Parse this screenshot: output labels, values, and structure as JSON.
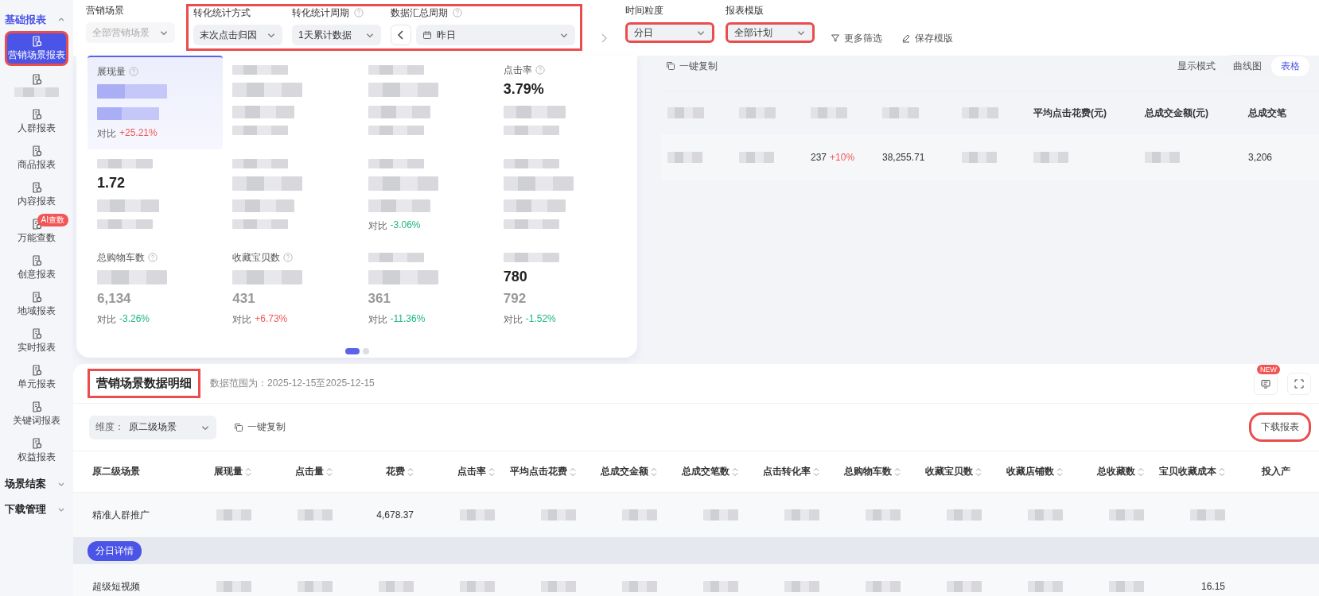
{
  "sidebar": {
    "groups": [
      {
        "label": "基础报表",
        "expanded": true,
        "items": [
          {
            "kind": "item",
            "label": "营销场景报表",
            "selected": true,
            "highlighted": true
          },
          {
            "kind": "redacted",
            "selected": false,
            "highlighted": false
          },
          {
            "kind": "item",
            "label": "人群报表",
            "selected": false,
            "highlighted": false
          },
          {
            "kind": "item",
            "label": "商品报表",
            "selected": false,
            "highlighted": false
          },
          {
            "kind": "item",
            "label": "内容报表",
            "selected": false,
            "highlighted": false
          },
          {
            "kind": "item",
            "label": "万能查数",
            "badge": "AI查数",
            "selected": false,
            "highlighted": false
          },
          {
            "kind": "item",
            "label": "创意报表",
            "selected": false,
            "highlighted": false
          },
          {
            "kind": "item",
            "label": "地域报表",
            "selected": false,
            "highlighted": false
          },
          {
            "kind": "item",
            "label": "实时报表",
            "selected": false,
            "highlighted": false
          },
          {
            "kind": "item",
            "label": "单元报表",
            "selected": false,
            "highlighted": false
          },
          {
            "kind": "item",
            "label": "关键词报表",
            "selected": false,
            "highlighted": false
          },
          {
            "kind": "item",
            "label": "权益报表",
            "selected": false,
            "highlighted": false
          }
        ]
      },
      {
        "label": "场景结案",
        "expanded": false
      },
      {
        "label": "下载管理",
        "expanded": false
      }
    ]
  },
  "filter_groups": [
    {
      "highlighted": false,
      "fields": [
        {
          "kind": "select",
          "label": "营销场景",
          "placeholder": "全部营销场景",
          "disabled": true,
          "highlighted": false
        }
      ]
    },
    {
      "highlighted": true,
      "fields": [
        {
          "kind": "select",
          "label": "转化统计方式",
          "value": "末次点击归因",
          "highlighted": false
        },
        {
          "kind": "select",
          "label": "转化统计周期",
          "help": true,
          "value": "1天累计数据",
          "highlighted": false
        },
        {
          "kind": "period",
          "label": "数据汇总周期",
          "help": true,
          "value": "昨日"
        }
      ]
    },
    {
      "highlighted": false,
      "fields": [
        {
          "kind": "next"
        }
      ]
    },
    {
      "highlighted": false,
      "fields": [
        {
          "kind": "select",
          "label": "时间粒度",
          "value": "分日",
          "highlighted": true
        }
      ]
    },
    {
      "highlighted": false,
      "fields": [
        {
          "kind": "select",
          "label": "报表模版",
          "value": "全部计划",
          "highlighted": true
        }
      ]
    },
    {
      "highlighted": false,
      "fields": [
        {
          "kind": "link",
          "label": "更多筛选"
        },
        {
          "kind": "link",
          "label": "保存模版"
        }
      ]
    }
  ],
  "metrics": [
    {
      "label": "展现量",
      "help": true,
      "compare_label": "对比",
      "change": "+25.21%",
      "color": "#f05858",
      "selected": true
    },
    {
      "selected": false
    },
    {
      "selected": false
    },
    {
      "label": "点击率",
      "help": true,
      "value": "3.79%",
      "selected": false
    },
    {
      "value": "1.72",
      "selected": false
    },
    {
      "selected": false
    },
    {
      "compare_label": "对比",
      "change": "-3.06%",
      "color": "#1db77b",
      "selected": false
    },
    {
      "selected": false
    },
    {
      "label": "总购物车数",
      "help": true,
      "previous": "6,134",
      "compare_label": "对比",
      "change": "-3.26%",
      "color": "#1db77b",
      "selected": false
    },
    {
      "label": "收藏宝贝数",
      "help": true,
      "previous": "431",
      "compare_label": "对比",
      "change": "+6.73%",
      "color": "#f05858",
      "selected": false
    },
    {
      "previous": "361",
      "compare_label": "对比",
      "change": "-11.36%",
      "color": "#1db77b",
      "selected": false
    },
    {
      "value": "780",
      "previous": "792",
      "compare_label": "对比",
      "change": "-1.52%",
      "color": "#1db77b",
      "selected": false
    }
  ],
  "pager": [
    {
      "selected": true
    },
    {
      "selected": false
    }
  ],
  "overview": {
    "copy": "一键复制",
    "mode_label": "显示模式",
    "modes": [
      {
        "label": "曲线图",
        "selected": false
      },
      {
        "label": "表格",
        "selected": true
      }
    ],
    "columns": [
      {},
      {},
      {},
      {},
      {},
      {
        "label": "平均点击花费(元)"
      },
      {
        "label": "总成交金额(元)"
      },
      {
        "label": "总成交笔"
      }
    ],
    "cells": [
      {},
      {},
      {
        "value": "237",
        "change": "+10%",
        "color": "#f05858"
      },
      {
        "value": "38,255.71"
      },
      {},
      {},
      {},
      {
        "value": "3,206"
      }
    ]
  },
  "detail": {
    "title": "营销场景数据明细",
    "highlighted": true,
    "range": "数据范围为：2025-12-15至2025-12-15",
    "badge": "NEW",
    "dimension": {
      "label": "维度：",
      "value": "原二级场景"
    },
    "copy": "一键复制",
    "download": {
      "label": "下载报表",
      "highlighted": true
    },
    "columns": [
      {
        "label": "原二级场景",
        "sortable": false
      },
      {
        "label": "展现量",
        "sortable": true
      },
      {
        "label": "点击量",
        "sortable": true
      },
      {
        "label": "花费",
        "sortable": true
      },
      {
        "label": "点击率",
        "sortable": true
      },
      {
        "label": "平均点击花费",
        "sortable": true
      },
      {
        "label": "总成交金额",
        "sortable": true
      },
      {
        "label": "总成交笔数",
        "sortable": true
      },
      {
        "label": "点击转化率",
        "sortable": true
      },
      {
        "label": "总购物车数",
        "sortable": true
      },
      {
        "label": "收藏宝贝数",
        "sortable": true
      },
      {
        "label": "收藏店铺数",
        "sortable": true
      },
      {
        "label": "总收藏数",
        "sortable": true
      },
      {
        "label": "宝贝收藏成本",
        "sortable": true
      },
      {
        "label": "投入产",
        "sortable": false
      }
    ],
    "rows": [
      {
        "kind": "data",
        "cells": [
          {
            "text": "精准人群推广"
          },
          {},
          {},
          {
            "text": "4,678.37"
          },
          {},
          {},
          {},
          {},
          {},
          {},
          {},
          {},
          {},
          {},
          {
            "kind": "empty"
          }
        ]
      },
      {
        "kind": "detail",
        "button": "分日详情"
      },
      {
        "kind": "data",
        "cells": [
          {
            "text": "超级短视频"
          },
          {},
          {},
          {},
          {},
          {},
          {},
          {},
          {},
          {},
          {},
          {},
          {},
          {
            "text": "16.15"
          },
          {
            "kind": "empty"
          }
        ]
      }
    ]
  }
}
